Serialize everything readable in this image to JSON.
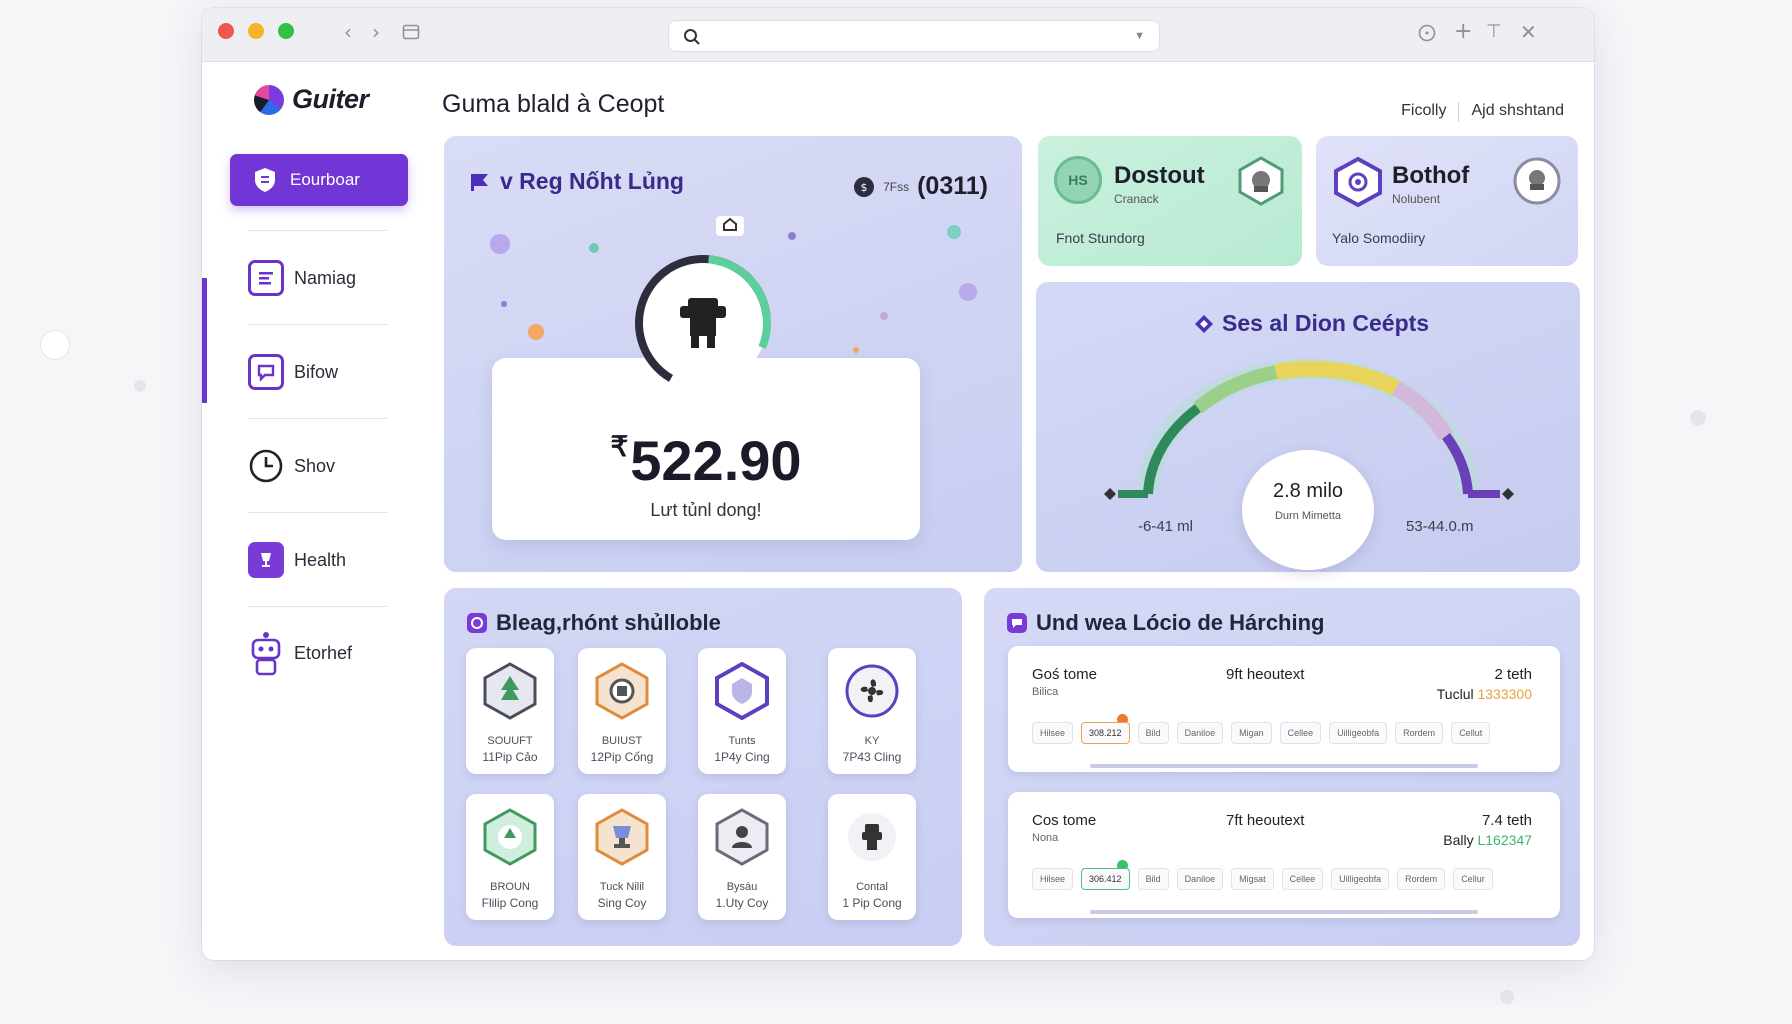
{
  "browser": {
    "search_placeholder": ""
  },
  "app": {
    "logo": "Guiter",
    "page_title": "Guma blald à Ceopt",
    "top_links": [
      "Ficolly",
      "Ajd shshtand"
    ]
  },
  "sidebar": {
    "active_label": "Eourboar",
    "items": [
      {
        "label": "Namiag",
        "icon": "document-icon"
      },
      {
        "label": "Bifow",
        "icon": "chat-icon"
      },
      {
        "label": "Shov",
        "icon": "clock-icon"
      },
      {
        "label": "Health",
        "icon": "cup-icon"
      },
      {
        "label": "Etorhef",
        "icon": "robot-icon"
      }
    ]
  },
  "main_card": {
    "title": "v Reg Nốht Lủng",
    "ref_small": "7Fss",
    "ref_big": "(0311)",
    "currency": "₹",
    "amount": "522.90",
    "subtitle": "Lưt tủnl dong!"
  },
  "stat_cards": [
    {
      "name": "Dostout",
      "sub": "Cranack",
      "foot": "Fnot Stundorg",
      "badge_text": "HS"
    },
    {
      "name": "Bothof",
      "sub": "Nolubent",
      "foot": "Yalo Somodiiry"
    }
  ],
  "gauge": {
    "title": "Ses al Dion Ceépts",
    "value": "2.8 milo",
    "value_label": "Durn Mimetta",
    "min_label": "-6-41 ml",
    "max_label": "53-44.0.m",
    "colors": [
      "#2e8a5a",
      "#9bd08a",
      "#e8d45a",
      "#d4b8dc",
      "#6a3fb8"
    ]
  },
  "badges": {
    "title": "Bleag,rhónt shủlloble",
    "items": [
      {
        "line1": "SOUUFT",
        "line2": "11Pip Cảo"
      },
      {
        "line1": "BUIUST",
        "line2": "12Pip Cống"
      },
      {
        "line1": "Tunts",
        "line2": "1P4y Cing"
      },
      {
        "line1": "KY",
        "line2": "7P43 Cling"
      },
      {
        "line1": "BROUN",
        "line2": "Flilip Cong"
      },
      {
        "line1": "Tuck Nilil",
        "line2": "Sing Coy"
      },
      {
        "line1": "Bysáu",
        "line2": "1.Uty Coy"
      },
      {
        "line1": "Contal",
        "line2": "1 Pip Cong"
      }
    ]
  },
  "list_card": {
    "title": "Und wea Lócio de Hárching",
    "rows": [
      {
        "title": "Goś tome",
        "sub": "Bilica",
        "middle": "9ft heoutext",
        "right": "2 teth",
        "right_label": "Tuclul",
        "right_value": "1333300",
        "chips": [
          "Hilsee",
          "308.212",
          "Bild",
          "Daniloe",
          "Migan",
          "Cellee",
          "Uilligeobfa",
          "Rordem",
          "Cellut"
        ],
        "selected": 1
      },
      {
        "title": "Cos tome",
        "sub": "Nona",
        "middle": "7ft heoutext",
        "right": "7.4 teth",
        "right_label": "Bally",
        "right_value": "L162347",
        "chips": [
          "Hilsee",
          "306.412",
          "Bild",
          "Daniloe",
          "Migsat",
          "Cellee",
          "Uilligeobfa",
          "Rordem",
          "Cellur"
        ],
        "selected": 1
      }
    ]
  }
}
